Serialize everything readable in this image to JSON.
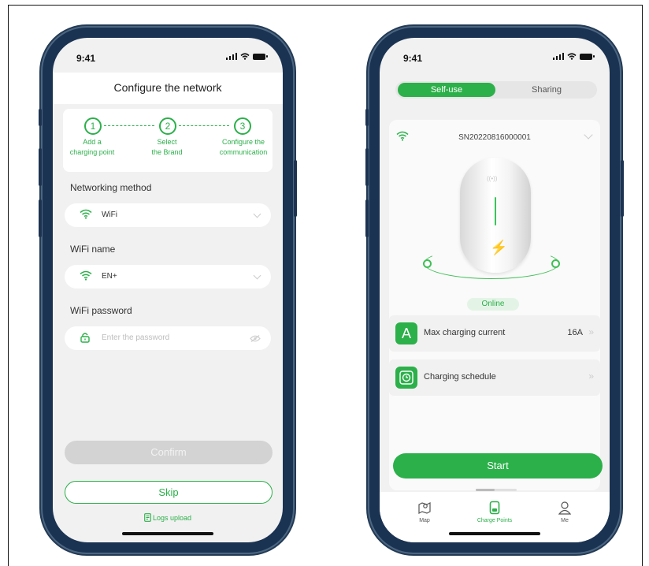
{
  "left_phone": {
    "status": {
      "time": "9:41"
    },
    "header": {
      "title": "Configure the network"
    },
    "steps": [
      {
        "num": "1",
        "label": "Add a\ncharging point"
      },
      {
        "num": "2",
        "label": "Select\nthe Brand"
      },
      {
        "num": "3",
        "label": "Configure the\ncommunication"
      }
    ],
    "networking": {
      "label": "Networking method",
      "value": "WiFi"
    },
    "wifi_name": {
      "label": "WiFi name",
      "value": "EN+"
    },
    "wifi_password": {
      "label": "WiFi password",
      "placeholder": "Enter the password"
    },
    "confirm_label": "Confirm",
    "skip_label": "Skip",
    "logs_label": "Logs upload"
  },
  "right_phone": {
    "status": {
      "time": "9:41"
    },
    "segment": {
      "active": "Self-use",
      "inactive": "Sharing"
    },
    "serial": "SN20220816000001",
    "status_badge": "Online",
    "max_current": {
      "label": "Max charging current",
      "value": "16A"
    },
    "schedule": {
      "label": "Charging schedule"
    },
    "start_label": "Start",
    "tabs": [
      {
        "label": "Map",
        "icon": "map-icon"
      },
      {
        "label": "Charge Points",
        "icon": "charge-point-icon"
      },
      {
        "label": "Me",
        "icon": "person-icon"
      }
    ]
  },
  "colors": {
    "accent": "#2cb04a",
    "phone_frame": "#1b3352",
    "screen_bg": "#f1f1f1"
  }
}
